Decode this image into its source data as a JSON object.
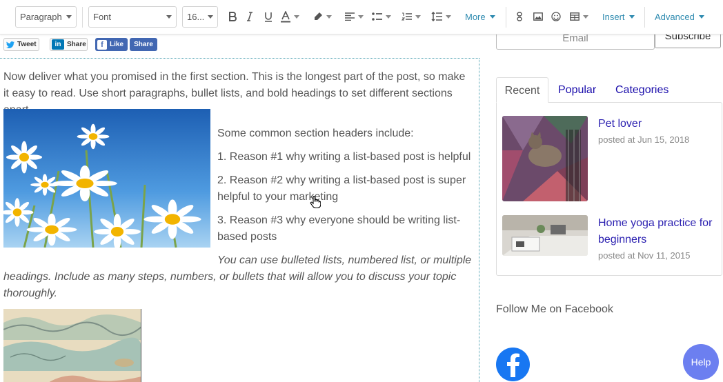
{
  "toolbar": {
    "paragraph_label": "Paragraph",
    "font_label": "Font",
    "size_label": "16...",
    "more_label": "More",
    "insert_label": "Insert",
    "advanced_label": "Advanced",
    "accent_color": "#2f8bb0"
  },
  "share": {
    "tweet_label": "Tweet",
    "linkedin_label": "Share",
    "facebook_like_label": "Like",
    "facebook_share_label": "Share"
  },
  "content": {
    "intro": "Now deliver what you promised in the first section. This is the longest part of the post, so make it easy to read. Use short paragraphs, bullet lists, and bold headings to set different sections apart.",
    "headers_intro": "Some common section headers include:",
    "reason1": "1. Reason #1 why writing a list-based post is helpful",
    "reason2": "2. Reason #2 why writing a list-based post is super helpful to your marketing",
    "reason3": "3. Reason #3 why everyone should be writing list-based posts",
    "italic_note": "You can use bulleted lists, numbered list, or multiple headings. Include as many steps, numbers, or bullets that will allow you to discuss your topic thoroughly."
  },
  "sidebar": {
    "email_placeholder": "Email",
    "subscribe_label": "Subscribe",
    "tabs": [
      {
        "label": "Recent"
      },
      {
        "label": "Popular"
      },
      {
        "label": "Categories"
      }
    ],
    "posts": [
      {
        "title": "Pet lover",
        "date": "posted at Jun 15, 2018"
      },
      {
        "title": "Home yoga practice for beginners",
        "date": "posted at Nov 11, 2015"
      }
    ],
    "follow_label": "Follow Me on Facebook"
  },
  "help_label": "Help"
}
